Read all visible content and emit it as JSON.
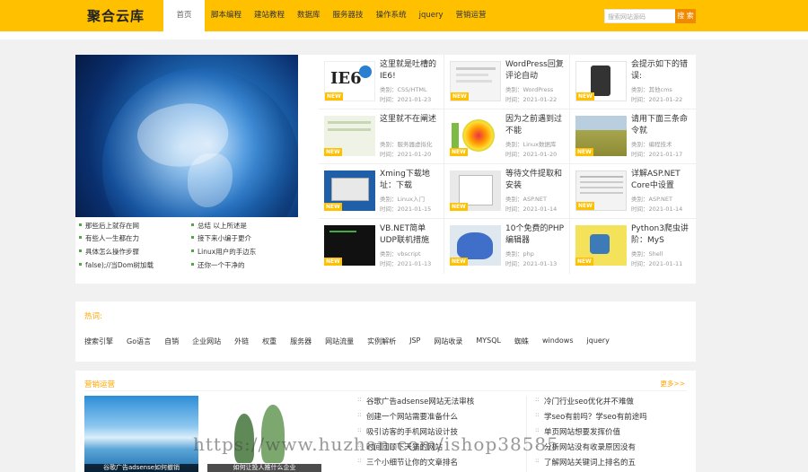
{
  "header": {
    "logo": "聚合云库",
    "nav": [
      "首页",
      "脚本编程",
      "建站教程",
      "数据库",
      "服务器技",
      "操作系统",
      "jquery",
      "营销运营"
    ],
    "search_placeholder": "搜索网站源码",
    "search_button": "搜 索"
  },
  "colors": {
    "brand": "#ffc000",
    "accent": "#f08a00",
    "hot": "#ffa500"
  },
  "featured_links": [
    "那些后上就存在网",
    "总结 以上所述是",
    "有些人一生都在力",
    "接下来小编于更介",
    "具体怎么操作步骤",
    "Linux用户的手边东",
    "false);//当Dom树加载",
    "还你一个干净的"
  ],
  "articles": [
    {
      "title": "这里就是吐槽的IE6!",
      "cat": "类别：CSS/HTML",
      "date": "时间：2021-01-23",
      "new": "NEW"
    },
    {
      "title": "WordPress回复评论自动",
      "cat": "类别：WordPress",
      "date": "时间：2021-01-22",
      "new": "NEW"
    },
    {
      "title": "会提示如下的错误:",
      "cat": "类别：其他cms",
      "date": "时间：2021-01-22",
      "new": "NEW"
    },
    {
      "title": "这里就不在阐述",
      "cat": "类别：服务器虚拟化",
      "date": "时间：2021-01-20",
      "new": "NEW"
    },
    {
      "title": "因为之前遇到过不能",
      "cat": "类别：Linux数据库",
      "date": "时间：2021-01-20",
      "new": "NEW"
    },
    {
      "title": "请用下面三条命令就",
      "cat": "类别：编程技术",
      "date": "时间：2021-01-17",
      "new": "NEW"
    },
    {
      "title": "Xming下载地址：下载",
      "cat": "类别：Linux入门",
      "date": "时间：2021-01-15",
      "new": "NEW"
    },
    {
      "title": "等待文件提取和安装",
      "cat": "类别：ASP.NET",
      "date": "时间：2021-01-14",
      "new": "NEW"
    },
    {
      "title": "详解ASP.NET Core中设置",
      "cat": "类别：ASP.NET",
      "date": "时间：2021-01-14",
      "new": "NEW"
    },
    {
      "title": "VB.NET简单UDP联机措施",
      "cat": "类别：vbscript",
      "date": "时间：2021-01-13",
      "new": "NEW"
    },
    {
      "title": "10个免费的PHP编辑器",
      "cat": "类别：php",
      "date": "时间：2021-01-13",
      "new": "NEW"
    },
    {
      "title": "Python3爬虫讲阶：MyS",
      "cat": "类别：Shell",
      "date": "时间：2021-01-11",
      "new": "NEW"
    }
  ],
  "hot": {
    "label": "热词:",
    "tags": [
      "搜索引擎",
      "Go语言",
      "自销",
      "企业网站",
      "外链",
      "权重",
      "服务器",
      "网站流量",
      "实例解析",
      "JSP",
      "网站收录",
      "MYSQL",
      "蜘蛛",
      "windows",
      "jquery"
    ]
  },
  "marketing": {
    "label": "营销运营",
    "more": "更多>>",
    "captions": [
      "谷歌广告adsense如何撤销",
      "如何让投人推什么企业"
    ],
    "col1": [
      "谷歌广告adsense网站无法审核",
      "创建一个网站需要准备什么",
      "吸引访客的手机网站设计技",
      "时间回顾下天猫的网站",
      "三个小细节让你的文章排名"
    ],
    "col2": [
      "冷门行业seo优化并不难做",
      "学seo有前吗？学seo有前途吗",
      "单页网站想要发挥价值",
      "分析网站没有收录原因没有",
      "了解网站关键词上排名的五"
    ]
  },
  "watermark": "https://www.huzhan.com/ishop38585"
}
